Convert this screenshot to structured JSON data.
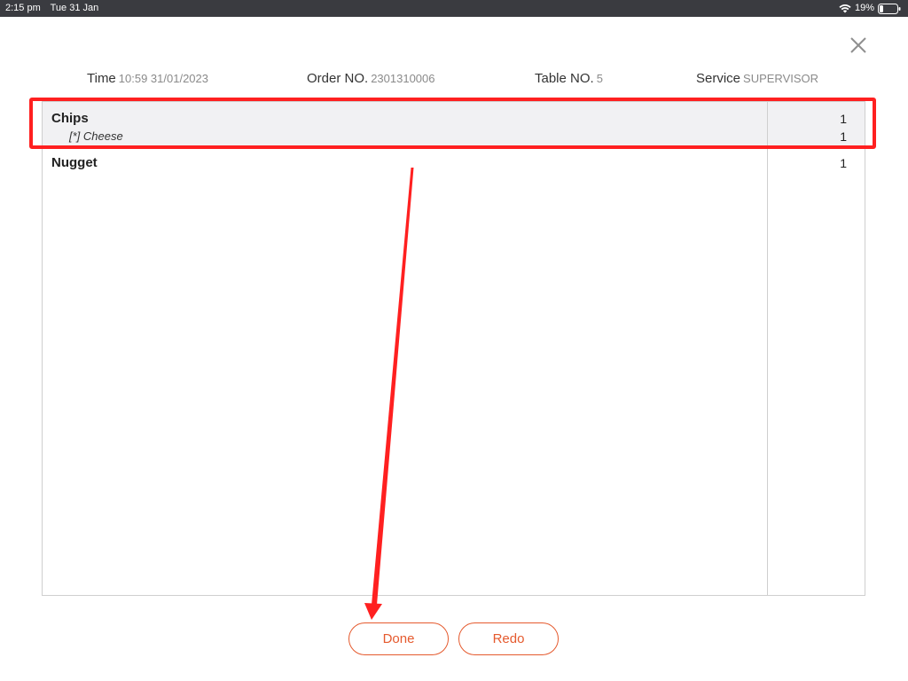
{
  "status_bar": {
    "time": "2:15 pm",
    "date": "Tue 31 Jan",
    "battery": "19%"
  },
  "header": {
    "time_label": "Time",
    "time_value": "10:59 31/01/2023",
    "order_label": "Order NO.",
    "order_value": "2301310006",
    "table_label": "Table NO.",
    "table_value": "5",
    "service_label": "Service",
    "service_value": "SUPERVISOR"
  },
  "items": [
    {
      "name": "Chips",
      "qty": "1",
      "modifier": "[*] Cheese",
      "modifier_qty": "1",
      "selected": true
    },
    {
      "name": "Nugget",
      "qty": "1",
      "selected": false
    }
  ],
  "buttons": {
    "done": "Done",
    "redo": "Redo"
  },
  "colors": {
    "accent": "#e55a2e",
    "annotation": "#ff2020",
    "status_bar": "#3a3b40",
    "selected_row": "#f1f1f3"
  },
  "icons": {
    "close": "close-icon",
    "wifi": "wifi-icon",
    "battery": "battery-icon"
  }
}
